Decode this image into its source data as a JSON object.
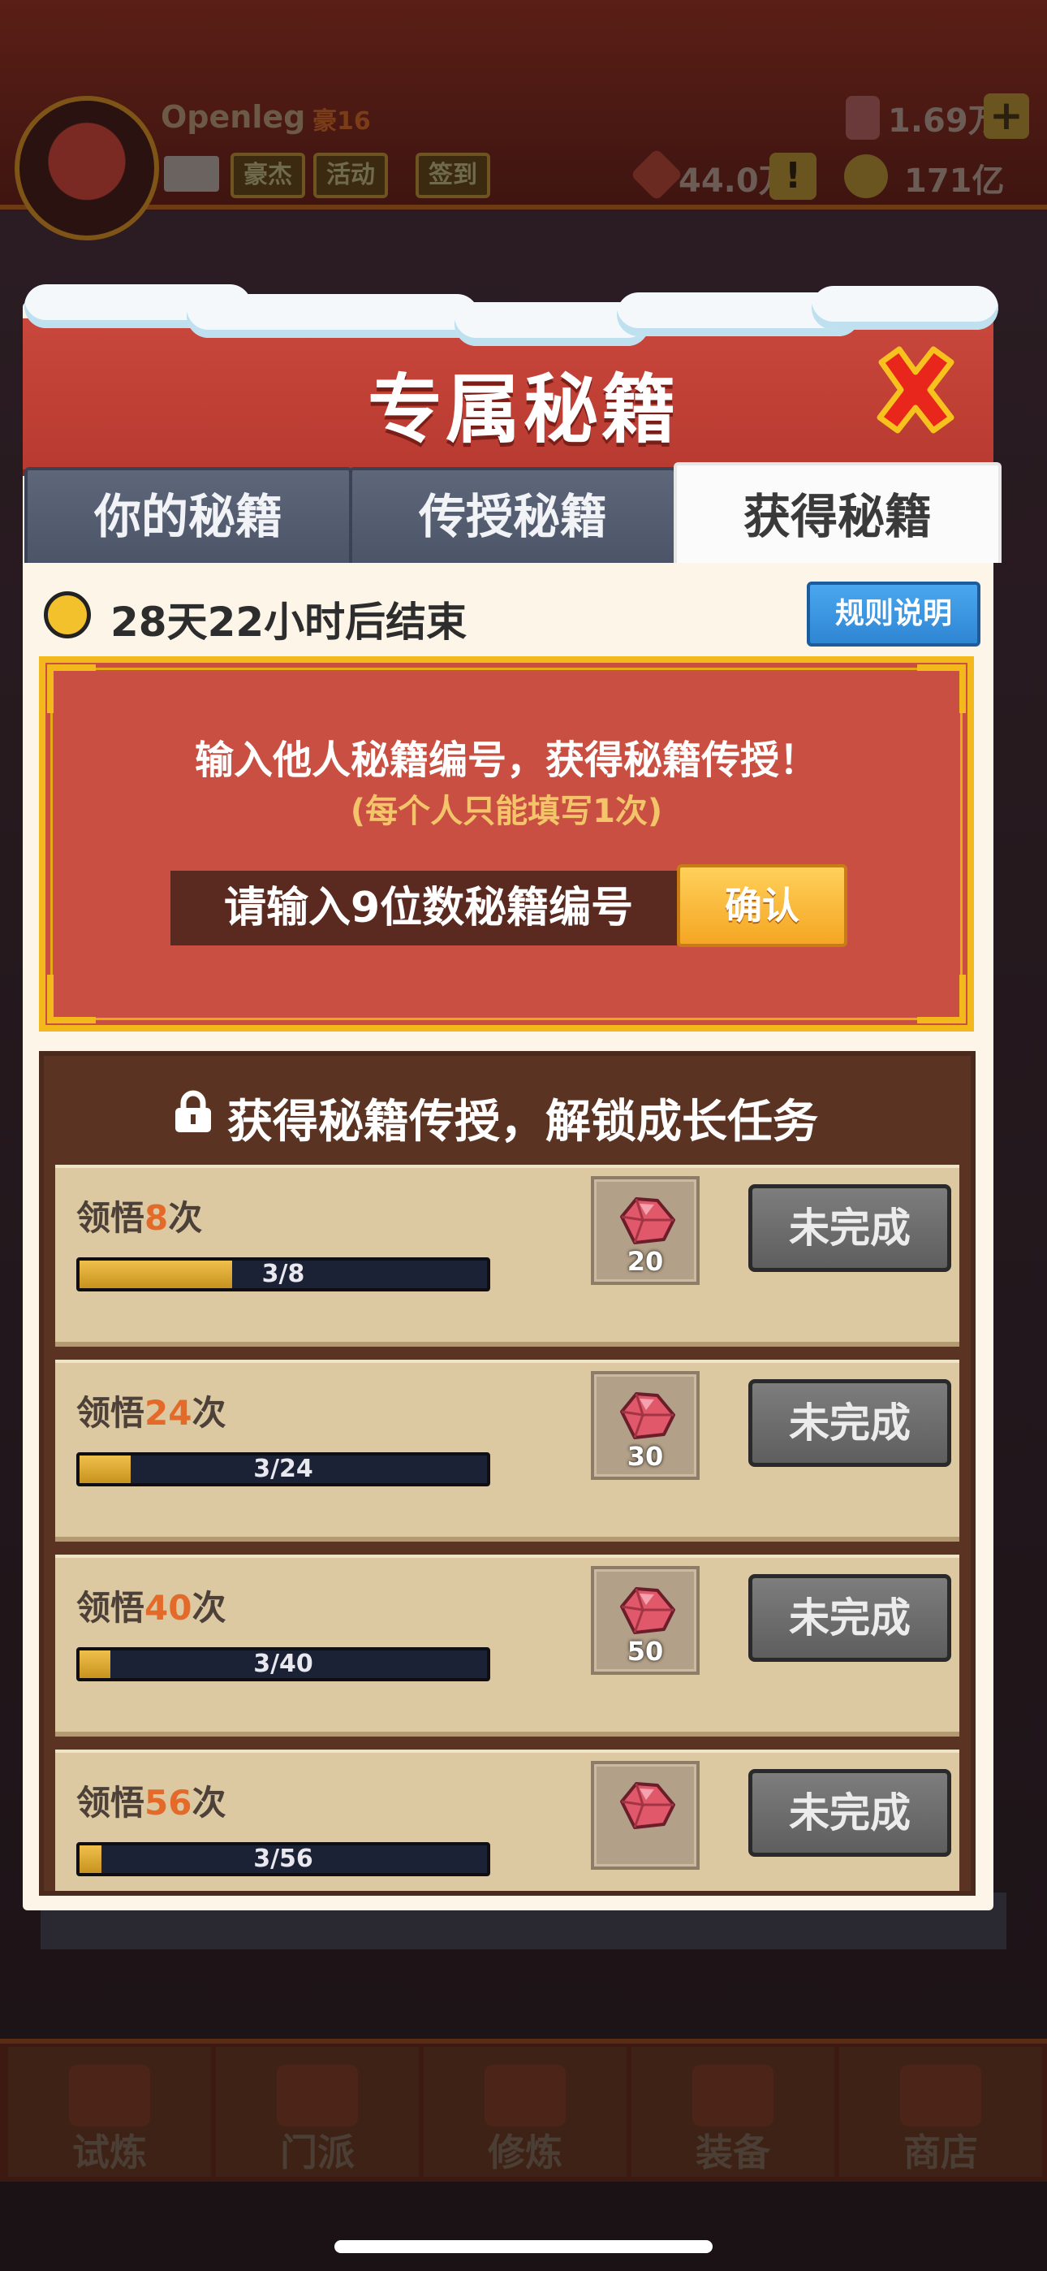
{
  "player": {
    "name": "Openleg",
    "vip": "豪16",
    "buttons": [
      "豪杰",
      "活动",
      "签到"
    ]
  },
  "currencies": {
    "gems": "1.69万",
    "tickets": "44.0万",
    "coins": "171亿"
  },
  "modal": {
    "title": "专属秘籍",
    "tabs": [
      {
        "label": "你的秘籍",
        "active": false
      },
      {
        "label": "传授秘籍",
        "active": false
      },
      {
        "label": "获得秘籍",
        "active": true
      }
    ],
    "timer": "28天22小时后结束",
    "rules_button": "规则说明",
    "input_panel": {
      "headline": "输入他人秘籍编号，获得秘籍传授！",
      "subtext": "(每个人只能填写1次)",
      "placeholder": "请输入9位数秘籍编号",
      "confirm_button": "确认"
    },
    "tasks": {
      "title": "获得秘籍传授，解锁成长任务",
      "items": [
        {
          "prefix": "领悟",
          "count": "8",
          "suffix": "次",
          "progress_text": "3/8",
          "progress": 0.375,
          "reward": "20",
          "status": "未完成"
        },
        {
          "prefix": "领悟",
          "count": "24",
          "suffix": "次",
          "progress_text": "3/24",
          "progress": 0.125,
          "reward": "30",
          "status": "未完成"
        },
        {
          "prefix": "领悟",
          "count": "40",
          "suffix": "次",
          "progress_text": "3/40",
          "progress": 0.075,
          "reward": "50",
          "status": "未完成"
        },
        {
          "prefix": "领悟",
          "count": "56",
          "suffix": "次",
          "progress_text": "3/56",
          "progress": 0.054,
          "reward": "",
          "status": "未完成"
        }
      ]
    }
  },
  "bottom_nav": [
    "试炼",
    "门派",
    "修炼",
    "装备",
    "商店"
  ],
  "colors": {
    "header_red": "#c84f41",
    "gold_border": "#f2b81c",
    "progress_gold": "#f0c04c",
    "task_bg": "#dcc9a2",
    "highlight_orange": "#e46a2a"
  }
}
